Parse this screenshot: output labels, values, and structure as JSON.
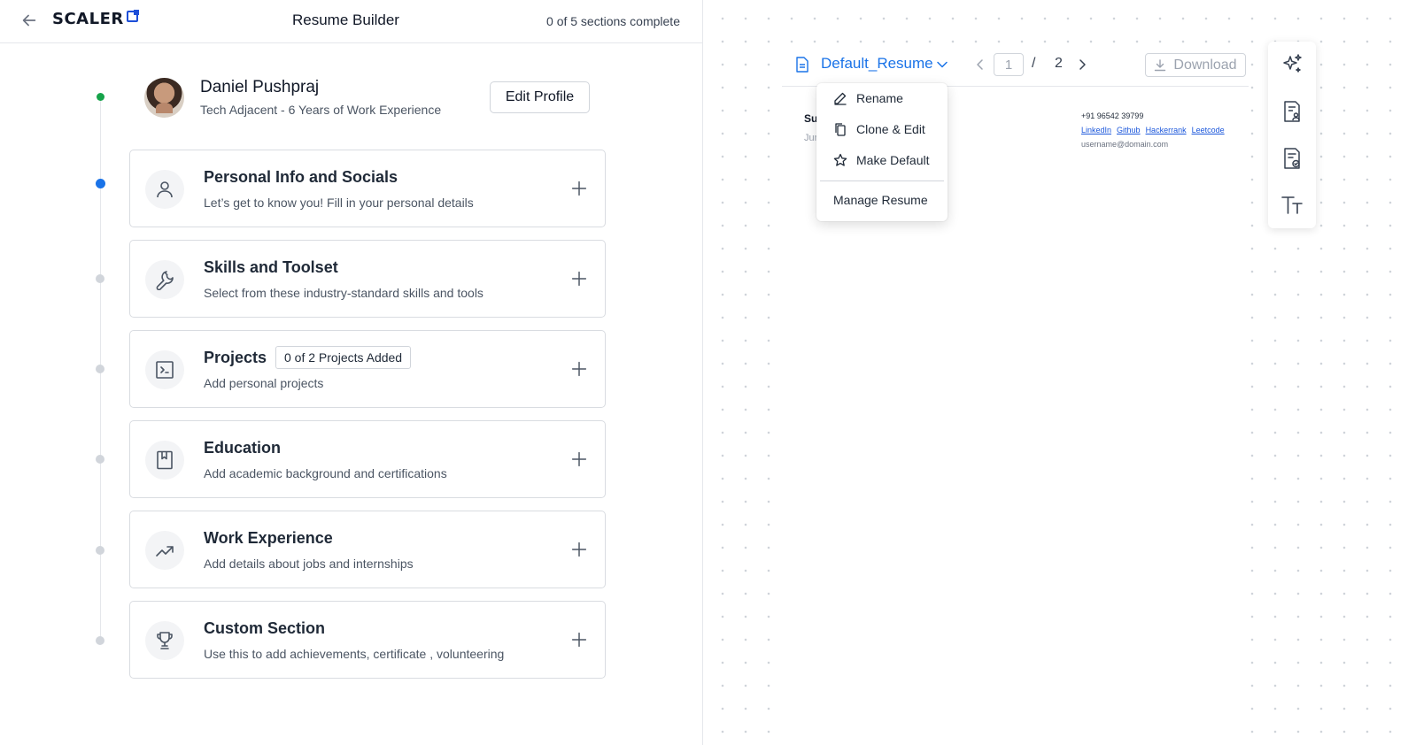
{
  "header": {
    "logo_text": "SCALER",
    "title": "Resume Builder",
    "progress": "0 of 5 sections complete"
  },
  "profile": {
    "name": "Daniel Pushpraj",
    "subtitle": "Tech Adjacent - 6 Years of Work Experience",
    "edit_label": "Edit Profile"
  },
  "sections": [
    {
      "title": "Personal Info and Socials",
      "desc": "Let’s get to know you! Fill in your personal details",
      "icon": "user-icon"
    },
    {
      "title": "Skills and Toolset",
      "desc": "Select from these industry-standard skills and tools",
      "icon": "wrench-icon"
    },
    {
      "title": "Projects",
      "badge": "0 of 2 Projects Added",
      "desc": "Add personal projects",
      "icon": "terminal-icon"
    },
    {
      "title": "Education",
      "desc": "Add academic background and certifications",
      "icon": "book-icon"
    },
    {
      "title": "Work Experience",
      "desc": "Add details about jobs and internships",
      "icon": "trending-up-icon"
    },
    {
      "title": "Custom Section",
      "desc": "Use this to add achievements, certificate , volunteering",
      "icon": "trophy-icon"
    }
  ],
  "preview": {
    "resume_name": "Default_Resume",
    "page_current": "1",
    "page_sep": "/",
    "page_total": "2",
    "download_label": "Download",
    "name_truncated": "Su",
    "sub_truncated": "Jur",
    "phone": "+91 96542 39799",
    "links": [
      "LinkedIn",
      "Github",
      "Hackerrank",
      "Leetcode"
    ],
    "email": "username@domain.com"
  },
  "menu": {
    "items": [
      {
        "label": "Rename",
        "icon": "pencil-icon"
      },
      {
        "label": "Clone & Edit",
        "icon": "copy-icon"
      },
      {
        "label": "Make Default",
        "icon": "star-icon"
      }
    ],
    "manage_label": "Manage Resume"
  },
  "tools": [
    "sparkles-icon",
    "resume-profile-icon",
    "resume-check-icon",
    "text-size-icon"
  ],
  "colors": {
    "accent": "#1a73e8",
    "complete": "#16a34a",
    "pending": "#d1d5db"
  }
}
